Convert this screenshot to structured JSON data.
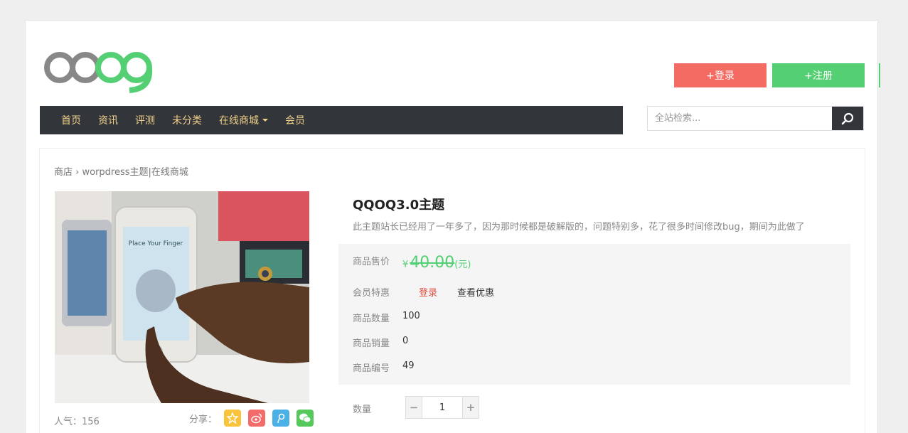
{
  "header": {
    "logo_text": "QQOQ",
    "login_label": "+登录",
    "register_label": "+注册"
  },
  "nav": {
    "items": [
      "首页",
      "资讯",
      "评测",
      "未分类",
      "在线商城",
      "会员"
    ]
  },
  "search": {
    "placeholder": "全站检索..."
  },
  "breadcrumb": {
    "shop": "商店",
    "sep": "›",
    "current": "worpdress主题|在线商城"
  },
  "product": {
    "title": "QQOQ3.0主题",
    "description": "此主题站长已经用了一年多了，因为那时候都是破解版的，问题特别多，花了很多时间修改bug，期间为此做了",
    "price_label": "商品售价",
    "currency": "¥",
    "price": "40.00",
    "price_unit": "(元)",
    "member_label": "会员特惠",
    "member_login": "登录",
    "member_view": "查看优惠",
    "stock_label": "商品数量",
    "stock": "100",
    "sales_label": "商品销量",
    "sales": "0",
    "sku_label": "商品编号",
    "sku": "49",
    "qty_label": "数量",
    "qty_value": "1",
    "popularity": "人气：156",
    "share_label": "分享：",
    "image_text": "Place Your Finger"
  },
  "colors": {
    "login_btn": "#f36b62",
    "register_btn": "#55cf73",
    "nav_bg": "#32353a",
    "nav_text": "#f1d18a",
    "price": "#55cf73"
  },
  "icons": [
    "search-icon",
    "qzone-icon",
    "weibo-icon",
    "tencent-weibo-icon",
    "wechat-icon",
    "minus-icon",
    "plus-icon",
    "dropdown-caret-icon"
  ]
}
